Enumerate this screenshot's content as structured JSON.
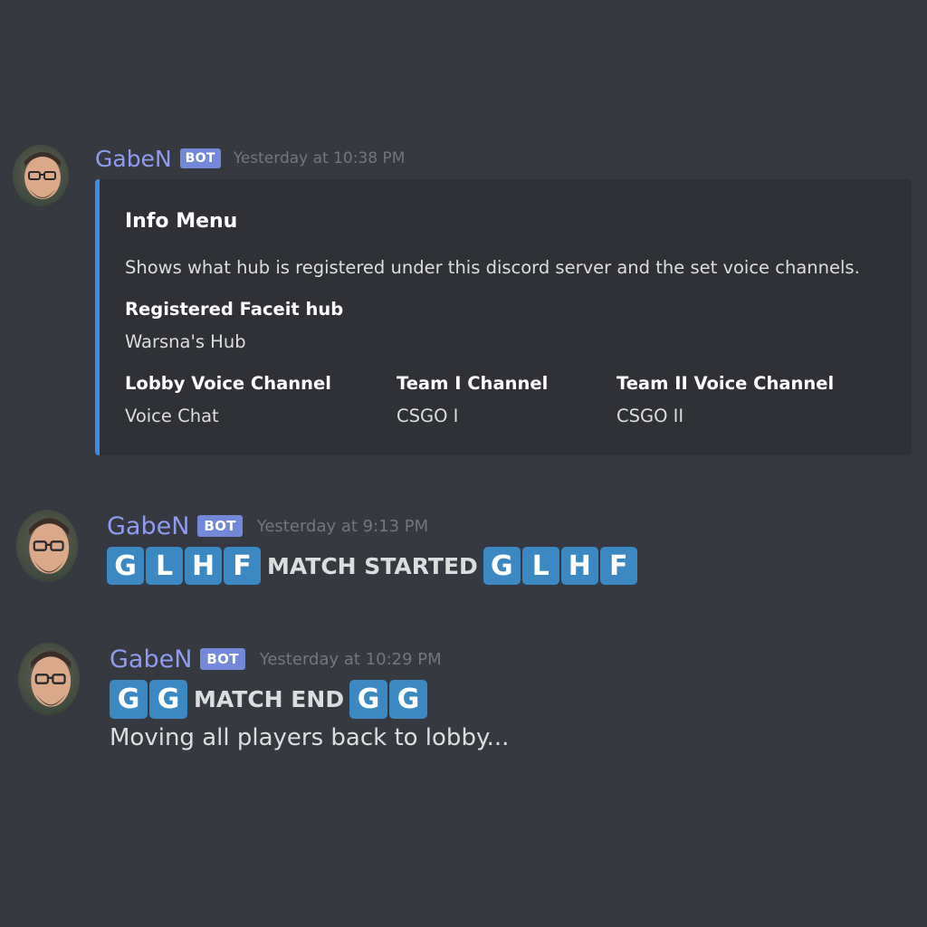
{
  "messages": [
    {
      "username": "GabeN",
      "bot_tag": "BOT",
      "timestamp": "Yesterday at 10:38 PM",
      "embed": {
        "title": "Info Menu",
        "description": "Shows what hub is registered under this discord server and the set voice channels.",
        "fields": [
          {
            "name": "Registered Faceit hub",
            "value": "Warsna's Hub"
          },
          {
            "name": "Lobby Voice Channel",
            "value": "Voice Chat"
          },
          {
            "name": "Team I Channel",
            "value": "CSGO I"
          },
          {
            "name": "Team II Voice Channel",
            "value": "CSGO II"
          }
        ],
        "accent_color": "#3a8ee6"
      }
    },
    {
      "username": "GabeN",
      "bot_tag": "BOT",
      "timestamp": "Yesterday at 9:13 PM",
      "lead_tiles": [
        "G",
        "L",
        "H",
        "F"
      ],
      "text": "MATCH STARTED",
      "trail_tiles": [
        "G",
        "L",
        "H",
        "F"
      ]
    },
    {
      "username": "GabeN",
      "bot_tag": "BOT",
      "timestamp": "Yesterday at 10:29 PM",
      "lead_tiles": [
        "G",
        "G"
      ],
      "text": "MATCH END",
      "trail_tiles": [
        "G",
        "G"
      ],
      "subtext": "Moving all players back to lobby..."
    }
  ],
  "colors": {
    "background": "#36393f",
    "embed_background": "#2f3136",
    "username": "#8e9cf0",
    "bot_tag": "#7289da",
    "tile": "#3b88c3"
  },
  "icons": {
    "avatar": "user-avatar"
  }
}
